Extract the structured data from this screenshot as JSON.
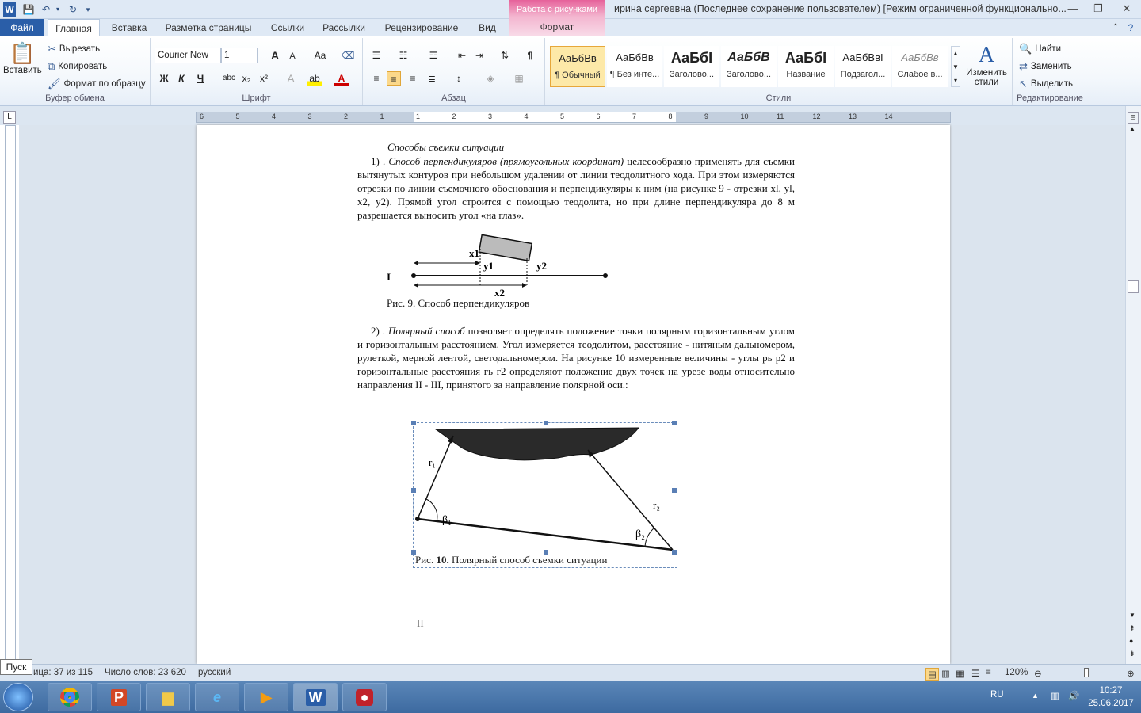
{
  "window": {
    "title": "ирина сергеевна (Последнее сохранение пользователем) [Режим ограниченной функционально...",
    "context_tab_title": "Работа с рисунками",
    "context_tab": "Формат"
  },
  "tabs": [
    "Файл",
    "Главная",
    "Вставка",
    "Разметка страницы",
    "Ссылки",
    "Рассылки",
    "Рецензирование",
    "Вид"
  ],
  "ribbon": {
    "clipboard": {
      "paste": "Вставить",
      "cut": "Вырезать",
      "copy": "Копировать",
      "format_painter": "Формат по образцу",
      "label": "Буфер обмена"
    },
    "font": {
      "name": "Courier New",
      "size": "1",
      "label": "Шрифт",
      "case_btn": "Aa",
      "bold": "Ж",
      "italic": "К",
      "underline": "Ч",
      "strike": "abc",
      "sub": "x₂",
      "sup": "x²",
      "grow": "A",
      "shrink": "A"
    },
    "paragraph": {
      "label": "Абзац"
    },
    "styles": {
      "label": "Стили",
      "items": [
        {
          "preview": "АаБбВв",
          "name": "¶ Обычный"
        },
        {
          "preview": "АаБбВв",
          "name": "¶ Без инте..."
        },
        {
          "preview": "АаБбI",
          "name": "Заголово..."
        },
        {
          "preview": "АаБбВ",
          "name": "Заголово..."
        },
        {
          "preview": "АаБбI",
          "name": "Название"
        },
        {
          "preview": "АаБбВвI",
          "name": "Подзагол..."
        },
        {
          "preview": "АаБбВв",
          "name": "Слабое в..."
        }
      ],
      "change": "Изменить стили"
    },
    "editing": {
      "find": "Найти",
      "replace": "Заменить",
      "select": "Выделить",
      "label": "Редактирование"
    }
  },
  "ruler": {
    "h_ticks": [
      "6",
      "5",
      "4",
      "3",
      "2",
      "1",
      "1",
      "2",
      "3",
      "4",
      "5",
      "6",
      "7",
      "8",
      "9",
      "10",
      "11",
      "12",
      "13",
      "14"
    ]
  },
  "document": {
    "heading": "Способы съемки ситуации",
    "p1_num": "1) .",
    "p1_em": "Способ перпендикуляров (прямоугольных координат)",
    "p1_rest": "целесообразно применять для съемки вытянутых контуров при небольшом удалении от линии теодолитного хода. При этом измеряются отрезки по линии съемочного обоснования и перпендикуляры к ним (на рисунке 9 - отрезки xl, yl, x2, y2). Прямой угол строится с помощью теодолита, но при длине перпендикуляра до 8 м разрешается выносить угол «на глаз».",
    "fig9": {
      "caption": "Рис. 9. Способ перпендикуляров",
      "x1": "x1",
      "y1": "y1",
      "y2": "y2",
      "x2": "x2",
      "I": "I"
    },
    "p2_num": "2) .",
    "p2_em": "Полярный способ",
    "p2_rest": "позволяет определять положение точки полярным горизонтальным углом и горизонтальным расстоянием. Угол измеряется теодолитом, расстояние - нитяным дальномером, рулеткой, мерной лентой, светодальномером. На рисунке 10 измеренные величины - углы рь р2 и горизонтальные расстояния гь г2 определяют положение двух точек на урезе воды относительно направления II - III, принятого за направление полярной оси.:",
    "fig10": {
      "caption_prefix": "Рис.",
      "caption_num": "10.",
      "caption_text": "Полярный способ съемки ситуации",
      "r1": "r₁",
      "r2": "r₂",
      "b1": "β₁",
      "b2": "β₂"
    },
    "marker_II": "II"
  },
  "status": {
    "page": "Страница: 37 из 115",
    "page_visible": "ица: 37 из 115",
    "words": "Число слов: 23 620",
    "lang": "русский",
    "zoom": "120%"
  },
  "taskbar": {
    "start_tooltip": "Пуск",
    "lang": "RU",
    "time": "10:27",
    "date": "25.06.2017"
  }
}
